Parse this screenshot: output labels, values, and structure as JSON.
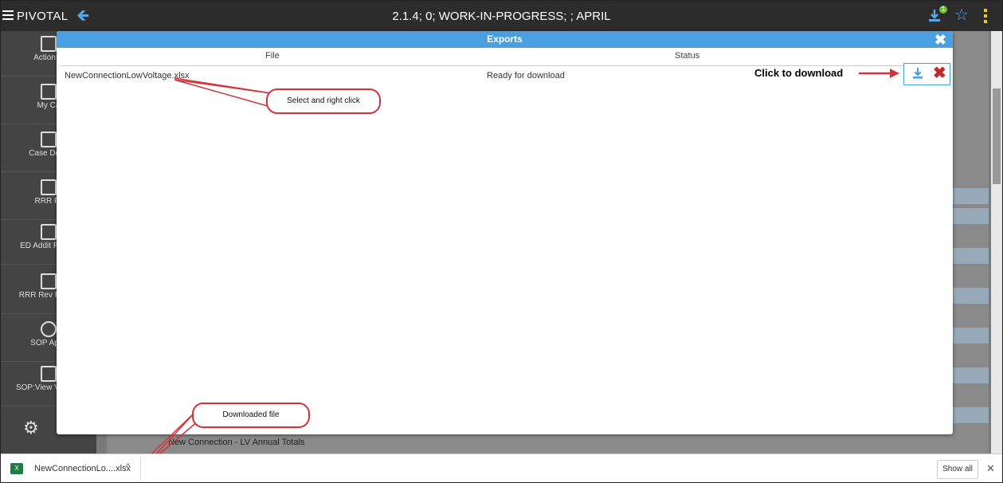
{
  "app": {
    "brand": "PIVOTAL",
    "title": "2.1.4; 0; WORK-IN-PROGRESS; ; APRIL",
    "download_badge": "1"
  },
  "sidebar": {
    "items": [
      {
        "label": "Action C"
      },
      {
        "label": "My Ca"
      },
      {
        "label": "Case Docu"
      },
      {
        "label": "RRR Fil"
      },
      {
        "label": "ED Addit Report"
      },
      {
        "label": "RRR Rev Reque"
      },
      {
        "label": "SOP Appli"
      },
      {
        "label": "SOP:View V Progr"
      }
    ]
  },
  "modal": {
    "title": "Exports",
    "columns": {
      "file": "File",
      "status": "Status"
    },
    "rows": [
      {
        "file": "NewConnectionLowVoltage.xlsx",
        "status": "Ready for download"
      }
    ]
  },
  "annotations": {
    "select_callout": "Select and right click",
    "downloaded_callout": "Downloaded file",
    "click_note": "Click to download"
  },
  "background": {
    "totals_label": "New Connection - LV Annual Totals"
  },
  "download_bar": {
    "file_name": "NewConnectionLo....xlsx",
    "show_all": "Show all"
  },
  "colors": {
    "accent": "#4a9fe0",
    "delete": "#c0282d",
    "callout_border": "#d0343b",
    "topbar": "#2c2c2c"
  }
}
